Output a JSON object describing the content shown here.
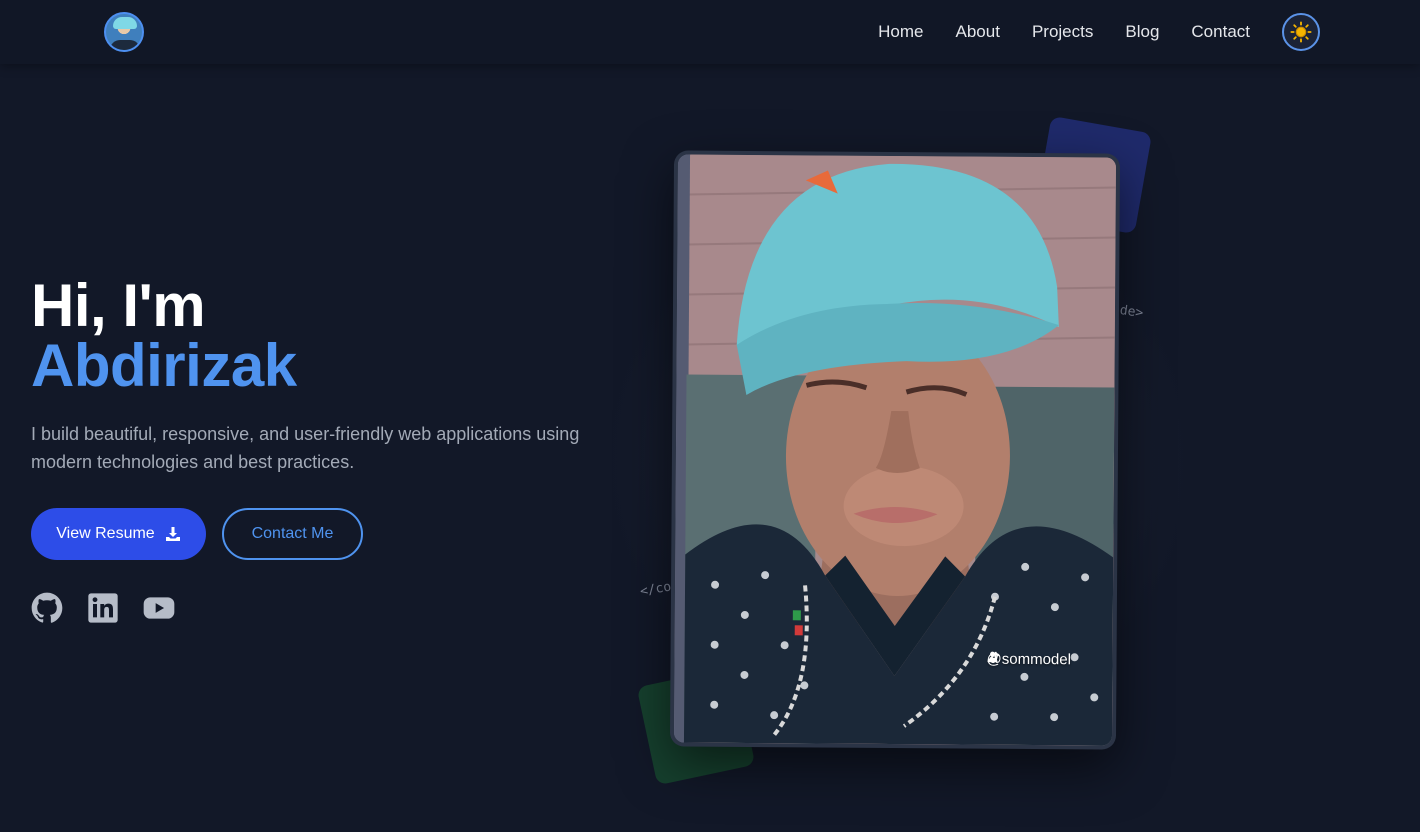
{
  "nav": {
    "links": [
      "Home",
      "About",
      "Projects",
      "Blog",
      "Contact"
    ],
    "theme_icon": "sun-icon"
  },
  "hero": {
    "greeting": "Hi, I'm",
    "name": "Abdirizak",
    "description": "I build beautiful, responsive, and user-friendly web applications using modern technologies and best practices.",
    "primary_button": "View Resume",
    "primary_button_icon": "download-icon",
    "secondary_button": "Contact Me",
    "socials": [
      "github-icon",
      "linkedin-icon",
      "youtube-icon"
    ]
  },
  "decor": {
    "code_tag_right": "ode>",
    "code_tag_left": "</co"
  },
  "photo": {
    "watermark": "@sommodel"
  },
  "colors": {
    "background": "#121828",
    "accent": "#4f93ef",
    "primary_button": "#2d4de8"
  }
}
